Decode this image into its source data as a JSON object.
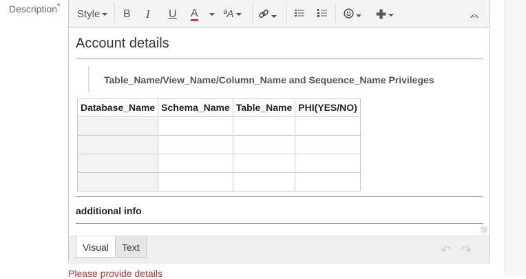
{
  "field": {
    "label": "Description",
    "required_mark": "*"
  },
  "toolbar": {
    "style_label": "Style",
    "bold": "B",
    "italic": "I",
    "underline": "U",
    "font_color": "A",
    "font_size": "ªA",
    "text_color_accent": "#e00000"
  },
  "content": {
    "heading": "Account details",
    "blockquote": "Table_Name/View_Name/Column_Name and Sequence_Name Privileges",
    "table": {
      "headers": [
        "Database_Name",
        "Schema_Name",
        "Table_Name",
        "PHI(YES/NO)"
      ],
      "rows": [
        [
          "",
          "",
          "",
          ""
        ],
        [
          "",
          "",
          "",
          ""
        ],
        [
          "",
          "",
          "",
          ""
        ],
        [
          "",
          "",
          "",
          ""
        ]
      ]
    },
    "additional": "additional info"
  },
  "footer": {
    "tabs": [
      {
        "label": "Visual",
        "active": true
      },
      {
        "label": "Text",
        "active": false
      }
    ]
  },
  "error": "Please provide details"
}
